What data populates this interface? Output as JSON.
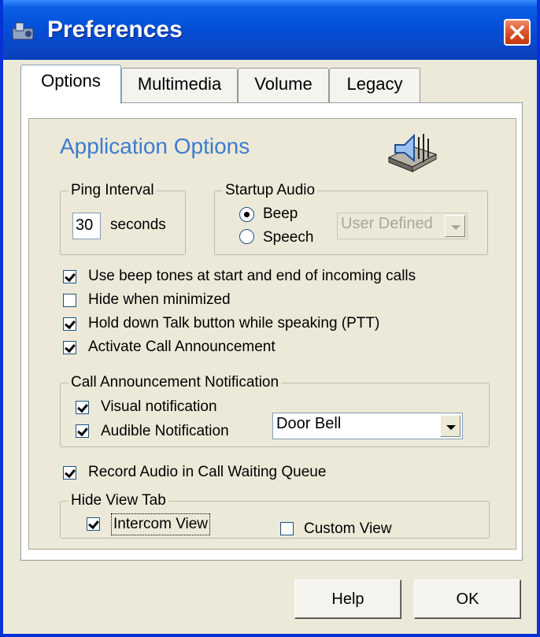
{
  "window": {
    "title": "Preferences",
    "close_icon": "close-icon",
    "app_icon": "app-icon"
  },
  "tabs": [
    {
      "label": "Options",
      "active": true
    },
    {
      "label": "Multimedia",
      "active": false
    },
    {
      "label": "Volume",
      "active": false
    },
    {
      "label": "Legacy",
      "active": false
    }
  ],
  "options": {
    "heading": "Application Options",
    "speaker_icon": "speaker-icon",
    "ping_interval": {
      "label": "Ping Interval",
      "value": "30",
      "unit": "seconds"
    },
    "startup_audio": {
      "label": "Startup Audio",
      "beep_label": "Beep",
      "speech_label": "Speech",
      "selected": "Beep",
      "sound_select": "User Defined"
    },
    "checks": {
      "beep_tones": {
        "label": "Use beep tones at start and end of incoming calls",
        "checked": true
      },
      "hide_minimized": {
        "label": "Hide when minimized",
        "checked": false
      },
      "hold_talk": {
        "label": "Hold down Talk button while speaking (PTT)",
        "checked": true
      },
      "activate_call": {
        "label": "Activate Call Announcement",
        "checked": true
      }
    },
    "call_notification": {
      "label": "Call Announcement Notification",
      "visual_label": "Visual notification",
      "visual_checked": true,
      "audible_label": "Audible Notification",
      "audible_checked": true,
      "sound_select": "Door Bell"
    },
    "record_audio": {
      "label": "Record Audio in Call Waiting Queue",
      "checked": true
    },
    "hide_view_tab": {
      "label": "Hide View Tab",
      "intercom_label": "Intercom View",
      "intercom_checked": true,
      "custom_label": "Custom View",
      "custom_checked": false
    }
  },
  "buttons": {
    "help": "Help",
    "ok": "OK"
  }
}
